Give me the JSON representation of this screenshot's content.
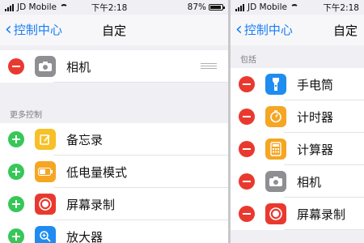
{
  "left": {
    "status": {
      "carrier": "JD Mobile",
      "time": "下午2:18",
      "battery_percent": "87%",
      "battery_level": 0.87
    },
    "nav": {
      "back": "控制中心",
      "title": "自定"
    },
    "included": [
      {
        "label": "相机",
        "icon": "camera-icon"
      }
    ],
    "more_header": "更多控制",
    "more": [
      {
        "label": "备忘录",
        "icon": "notes-icon"
      },
      {
        "label": "低电量模式",
        "icon": "low-power-icon"
      },
      {
        "label": "屏幕录制",
        "icon": "screen-record-icon"
      },
      {
        "label": "放大器",
        "icon": "magnifier-icon"
      }
    ]
  },
  "right": {
    "status": {
      "carrier": "JD Mobile",
      "time": "下午2:18"
    },
    "nav": {
      "back": "控制中心",
      "title": "自定"
    },
    "include_header": "包括",
    "included": [
      {
        "label": "手电筒",
        "icon": "flashlight-icon"
      },
      {
        "label": "计时器",
        "icon": "timer-icon"
      },
      {
        "label": "计算器",
        "icon": "calculator-icon"
      },
      {
        "label": "相机",
        "icon": "camera-icon"
      },
      {
        "label": "屏幕录制",
        "icon": "screen-record-icon"
      }
    ]
  },
  "colors": {
    "accent": "#1a7ef5",
    "remove": "#e9392f",
    "add": "#37c759"
  }
}
